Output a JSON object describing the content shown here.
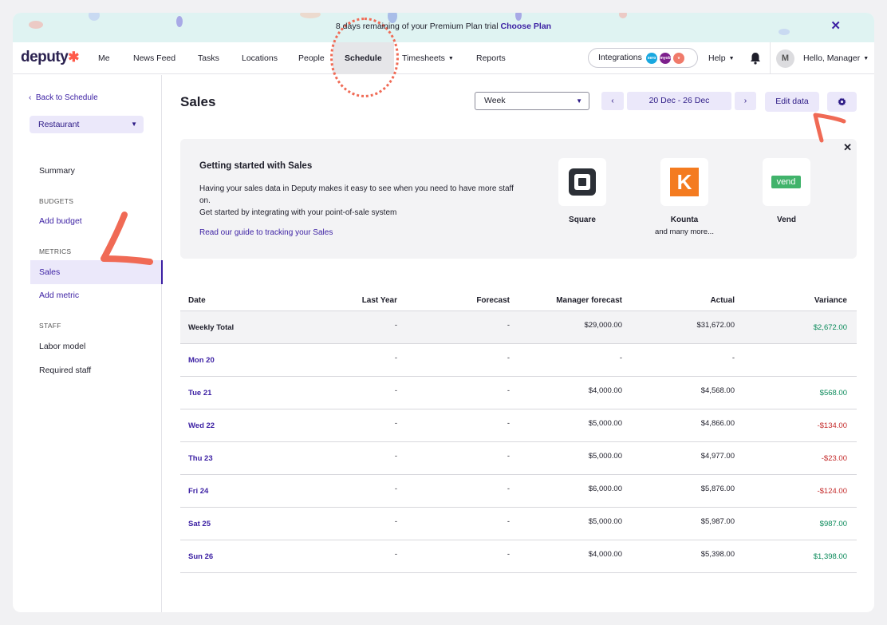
{
  "banner": {
    "text": "8 days remaining of your Premium Plan trial ",
    "cta": "Choose Plan",
    "close": "✕"
  },
  "nav": {
    "logo": "deputy",
    "items": [
      "Me",
      "News Feed",
      "Tasks",
      "Locations",
      "People",
      "Schedule",
      "Timesheets",
      "Reports"
    ],
    "active": "Schedule",
    "integrations_label": "Integrations",
    "integration_badges": [
      "xero",
      "myob",
      "v"
    ],
    "help": "Help",
    "avatar_initial": "M",
    "user": "Hello, Manager"
  },
  "sidebar": {
    "back": "Back to Schedule",
    "location": "Restaurant",
    "summary": "Summary",
    "budgets_head": "BUDGETS",
    "add_budget": "Add budget",
    "metrics_head": "METRICS",
    "sales": "Sales",
    "add_metric": "Add metric",
    "staff_head": "STAFF",
    "labor_model": "Labor model",
    "required_staff": "Required staff"
  },
  "header": {
    "title": "Sales",
    "period": "Week",
    "prev": "‹",
    "range": "20 Dec - 26 Dec",
    "next": "›",
    "edit": "Edit data"
  },
  "card": {
    "title": "Getting started with Sales",
    "body1": "Having your sales data in Deputy makes it easy to see when you need to have more staff on.",
    "body2": "Get started by integrating with your point-of-sale system",
    "link": "Read our guide to tracking your Sales",
    "close": "✕",
    "integrations": [
      {
        "name": "Square",
        "sub": ""
      },
      {
        "name": "Kounta",
        "sub": "and many more..."
      },
      {
        "name": "Vend",
        "sub": ""
      }
    ],
    "vend_logo_text": "vend",
    "kounta_logo_text": "K"
  },
  "table": {
    "headers": [
      "Date",
      "Last Year",
      "Forecast",
      "Manager forecast",
      "Actual",
      "Variance"
    ],
    "rows": [
      {
        "date": "Weekly Total",
        "ly": "-",
        "fc": "-",
        "mf": "$29,000.00",
        "ac": "$31,672.00",
        "va": "$2,672.00",
        "sign": "pos"
      },
      {
        "date": "Mon 20",
        "ly": "-",
        "fc": "-",
        "mf": "-",
        "ac": "-",
        "va": "",
        "sign": ""
      },
      {
        "date": "Tue 21",
        "ly": "-",
        "fc": "-",
        "mf": "$4,000.00",
        "ac": "$4,568.00",
        "va": "$568.00",
        "sign": "pos"
      },
      {
        "date": "Wed 22",
        "ly": "-",
        "fc": "-",
        "mf": "$5,000.00",
        "ac": "$4,866.00",
        "va": "-$134.00",
        "sign": "neg"
      },
      {
        "date": "Thu 23",
        "ly": "-",
        "fc": "-",
        "mf": "$5,000.00",
        "ac": "$4,977.00",
        "va": "-$23.00",
        "sign": "neg"
      },
      {
        "date": "Fri 24",
        "ly": "-",
        "fc": "-",
        "mf": "$6,000.00",
        "ac": "$5,876.00",
        "va": "-$124.00",
        "sign": "neg"
      },
      {
        "date": "Sat 25",
        "ly": "-",
        "fc": "-",
        "mf": "$5,000.00",
        "ac": "$5,987.00",
        "va": "$987.00",
        "sign": "pos"
      },
      {
        "date": "Sun 26",
        "ly": "-",
        "fc": "-",
        "mf": "$4,000.00",
        "ac": "$5,398.00",
        "va": "$1,398.00",
        "sign": "pos"
      }
    ]
  },
  "colors": {
    "brand": "#3b1fa3",
    "banner_bg": "#dff3f2",
    "annotation": "#f06a55",
    "positive": "#0a8a5a",
    "negative": "#c42b2b"
  }
}
